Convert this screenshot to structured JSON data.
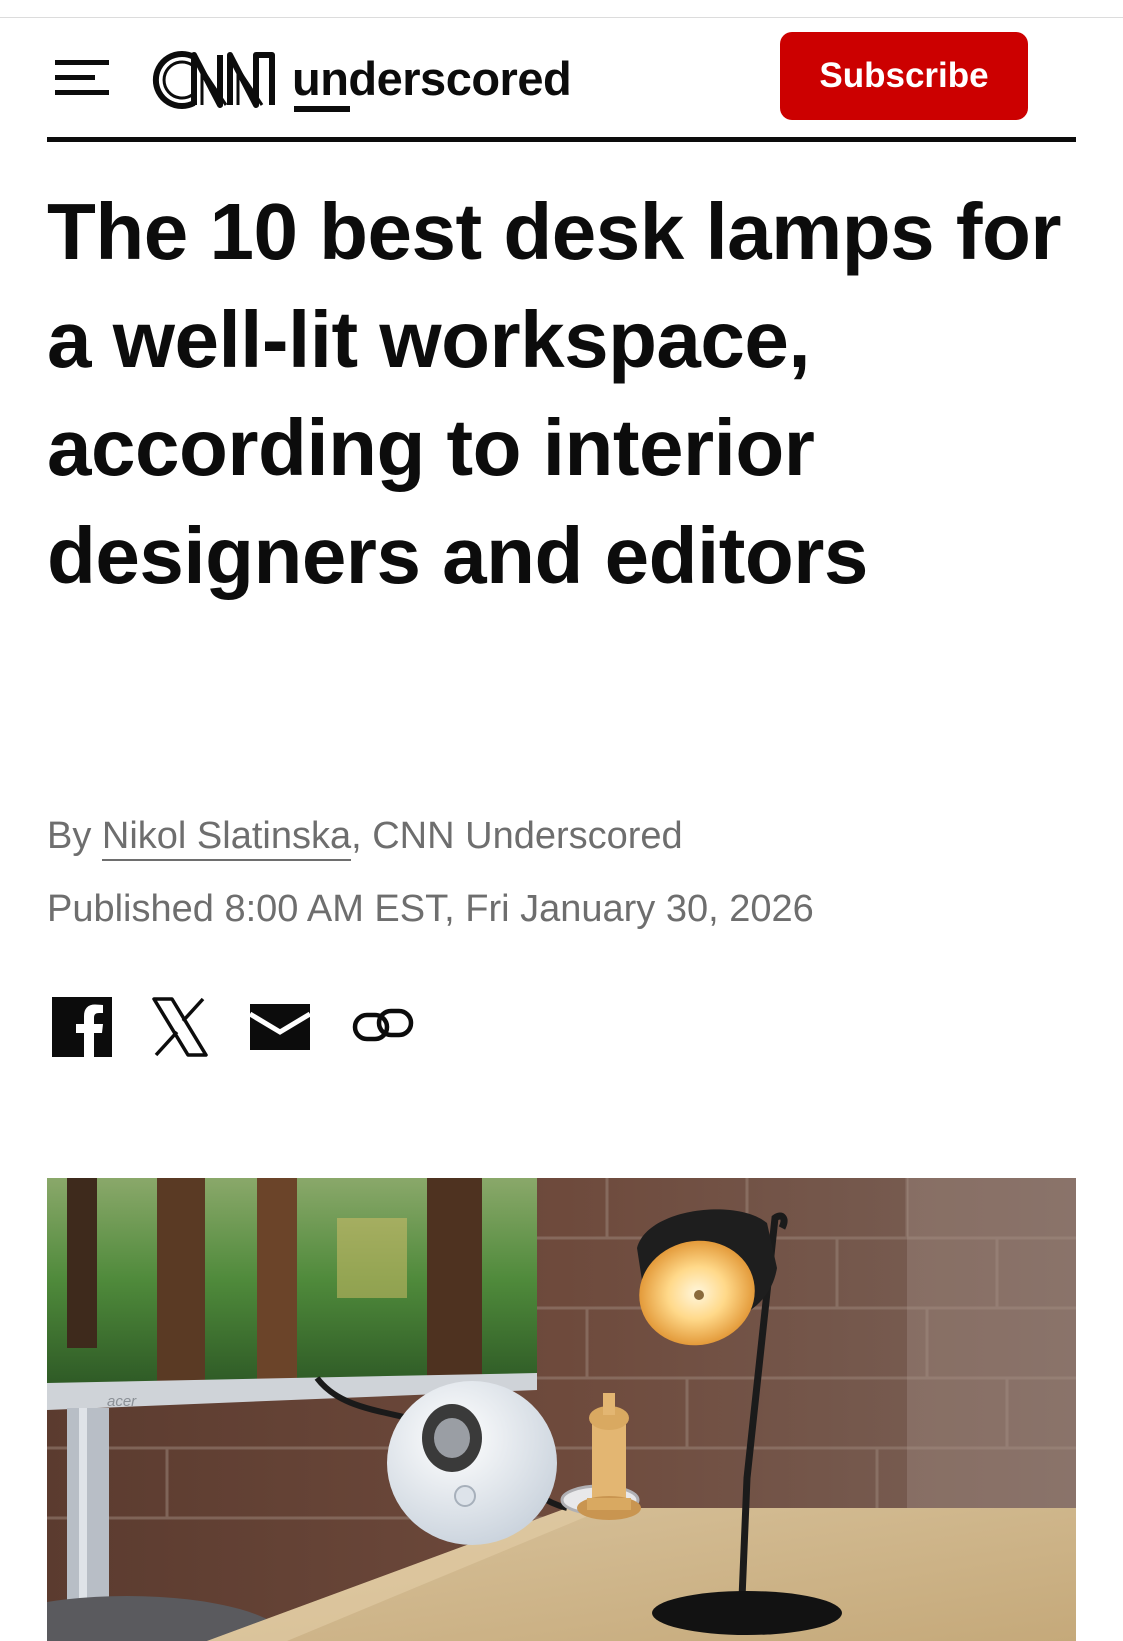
{
  "header": {
    "menu_icon": "hamburger-menu-icon",
    "logo_brand": "CNN",
    "logo_word": "underscored",
    "subscribe_label": "Subscribe",
    "accent_color": "#cc0000"
  },
  "article": {
    "headline": "The 10 best desk lamps for a well-lit workspace, according to interior designers and editors",
    "byline_prefix": "By ",
    "author": "Nikol Slatinska",
    "byline_suffix": ", CNN Underscored",
    "published": "Published 8:00 AM EST, Fri January 30, 2026"
  },
  "share": {
    "icons": [
      "facebook-icon",
      "x-icon",
      "email-icon",
      "link-icon"
    ]
  },
  "hero_image": {
    "monitor_brand": "acer"
  }
}
